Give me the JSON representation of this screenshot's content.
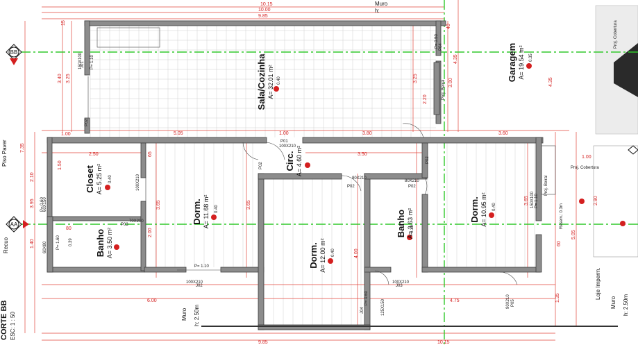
{
  "section": {
    "title": "CORTE BB",
    "scale": "ESC: 1 : 50"
  },
  "axes": {
    "bb": "BB",
    "aa": "AA"
  },
  "rooms": [
    {
      "name": "Sala/Cozinha",
      "area": "A= 32.01 m²",
      "level": "0.40"
    },
    {
      "name": "Garagem",
      "area": "A= 19.54 m²",
      "level": "0.35"
    },
    {
      "name": "Closet",
      "area": "A= 5.25 m²",
      "level": "0.40"
    },
    {
      "name": "Circ.",
      "area": "A= 4.60 m²",
      "level": "0.40"
    },
    {
      "name": "Dorm.",
      "area": "A= 11.68 m²",
      "level": "0.40"
    },
    {
      "name": "Dorm.",
      "area": "A= 10.95 m²",
      "level": "0.40"
    },
    {
      "name": "Dorm.",
      "area": "A= 12.00 m²",
      "level": "0.40"
    },
    {
      "name": "Banho",
      "area": "A= 3.50 m²",
      "level": "0.39"
    },
    {
      "name": "Banho",
      "area": "A= 3.63 m²",
      "level": "0.39"
    }
  ],
  "labels": {
    "piso_paver": "Piso Paver",
    "recuo": "Recuo",
    "muro_left": "Muro",
    "muro_left_h": "h: 2.50m",
    "muro_right": "Muro",
    "muro_right_h": "h: 2.50m",
    "loje": "Loje Imperm.",
    "proj_cobertura_top": "Proj. Cobertura",
    "proj_cobertura_mid": "Proj. Cobertura",
    "proj_beiral": "Proj. Beiral",
    "reserv": "Reserv.: 0.3m",
    "top_muro": "Muro",
    "top_h": "h:"
  },
  "tags": {
    "p01": "P01",
    "p02": "P02",
    "p03": "P03",
    "p04": "P04",
    "p05": "P05",
    "j01": "J01",
    "j02": "J02",
    "j03": "J03",
    "j04": "J04",
    "s80x210": "80X210",
    "s70x210": "70X210",
    "s60x210": "60X210",
    "s100x210": "100X210",
    "s90x210": "90X210",
    "s150x100": "150X100",
    "s120x100": "120X100",
    "s125x150": "125X150",
    "s60x150": "60X150",
    "s60x80": "60X80",
    "pe110": "P= 1.10",
    "pe060": "P= 0.60",
    "pe160": "P= 1.60",
    "pe050": "P= 0.50"
  },
  "dims": {
    "top1": "10.15",
    "top2": "10.00",
    "top3": "9.85",
    "sala_w": "5.05",
    "d100": "1.00",
    "d380": "3.80",
    "d360": "3.60",
    "d340": "3.40",
    "d325": "3.25",
    "d110": "1.10",
    "d735": "7.35",
    "d395": "3.95",
    "d210": "2.10",
    "d150": "1.50",
    "d250": "2.50",
    "d365": "3.65",
    "d200": "2.00",
    "d140": "1.40",
    "d350": "3.50",
    "d400": "4.00",
    "d600": "6.00",
    "d475": "4.75",
    "d335": "3.35",
    "d435": "4.35",
    "d300": "3.00",
    "d220": "2.20",
    "d290": "2.90",
    "d285": "2.85",
    "d505": "5.05",
    "d135": "1.35",
    "d065": "65",
    "d080": "80",
    "d060": "60",
    "d040": "40",
    "d015": "15",
    "d010": "10",
    "bot1": "9.85",
    "bot2": "10.15"
  }
}
